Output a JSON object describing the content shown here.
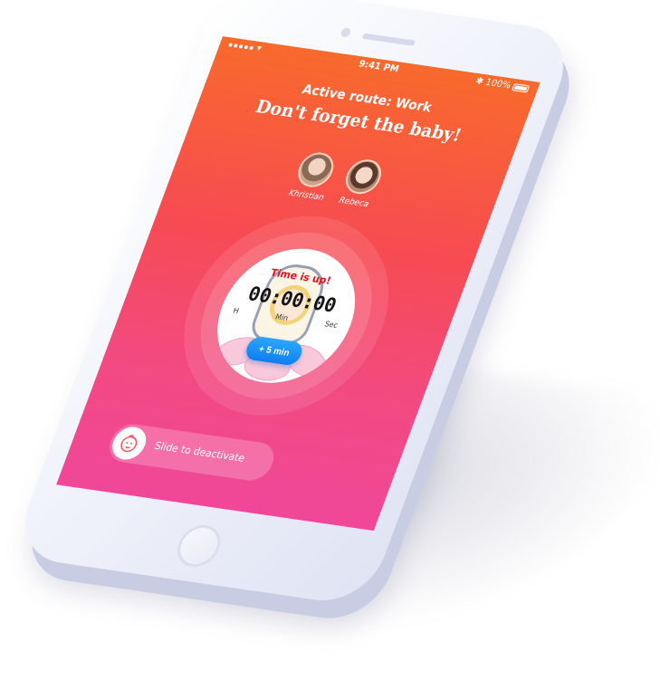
{
  "status_bar": {
    "time": "9:41 PM",
    "battery": "100%",
    "wifi_icon": "wifi-icon",
    "bluetooth_icon": "bluetooth-icon"
  },
  "header": {
    "route": "Active route: Work",
    "headline": "Don't forget the baby!"
  },
  "children": [
    {
      "name": "Khristian"
    },
    {
      "name": "Rebeca"
    }
  ],
  "timer": {
    "alert": "Time is up!",
    "hours": "00",
    "minutes": "00",
    "seconds": "00",
    "hours_label": "H",
    "minutes_label": "Min",
    "seconds_label": "Sec",
    "add_button": "+ 5 min"
  },
  "slider": {
    "label": "Slide to deactivate",
    "icon": "baby-face-icon"
  },
  "colors": {
    "gradient_top": "#f86a2c",
    "gradient_bottom": "#f0479a",
    "button_blue": "#1a8ff5",
    "alert_red": "#e5101d"
  }
}
